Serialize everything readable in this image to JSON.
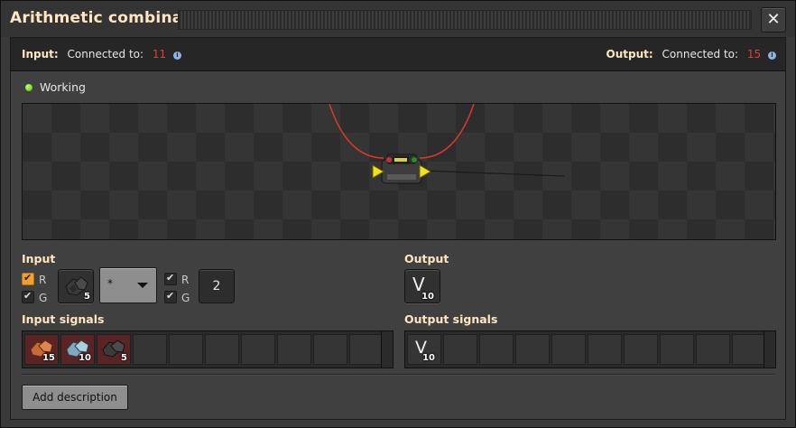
{
  "window": {
    "title": "Arithmetic combinator",
    "close_glyph": "✕"
  },
  "connections": {
    "input": {
      "header": "Input:",
      "label": "Connected to:",
      "count": "11",
      "info_icon": "info-icon"
    },
    "output": {
      "header": "Output:",
      "label": "Connected to:",
      "count": "15",
      "info_icon": "info-icon"
    }
  },
  "status": {
    "text": "Working",
    "color": "#7ed321"
  },
  "input": {
    "title": "Input",
    "checkboxes": [
      {
        "label": "R",
        "checked": true,
        "style": "orange"
      },
      {
        "label": "G",
        "checked": true
      }
    ],
    "first_signal": {
      "icon": "coal-icon",
      "count": "5"
    },
    "operator": "*",
    "second_checkboxes": [
      {
        "label": "R",
        "checked": true
      },
      {
        "label": "G",
        "checked": true
      }
    ],
    "constant": "2"
  },
  "output": {
    "title": "Output",
    "signal": {
      "letter": "V",
      "count": "10"
    }
  },
  "input_signals": {
    "title": "Input signals",
    "items": [
      {
        "icon": "copper-ore-icon",
        "count": "15",
        "color": "#d06a3a"
      },
      {
        "icon": "iron-ore-icon",
        "count": "10",
        "color": "#8fb6c8"
      },
      {
        "icon": "coal-icon",
        "count": "5",
        "color": "#3a3a3a"
      }
    ]
  },
  "output_signals": {
    "title": "Output signals",
    "items": [
      {
        "letter": "V",
        "count": "10"
      }
    ]
  },
  "actions": {
    "add_description": "Add description"
  },
  "colors": {
    "accent_title": "#ffe6c0",
    "count_red": "#e04040",
    "wire_red": "#e0352b"
  }
}
